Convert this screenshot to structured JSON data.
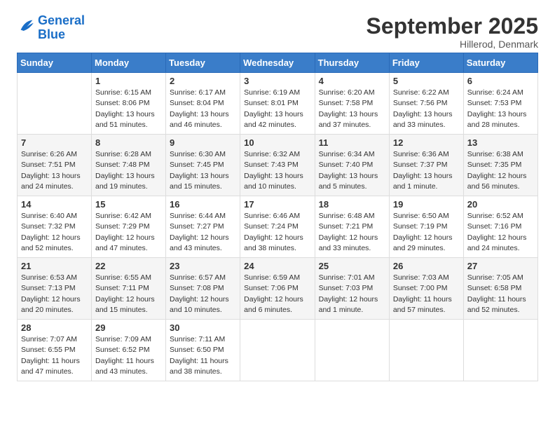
{
  "header": {
    "logo_general": "General",
    "logo_blue": "Blue",
    "month_title": "September 2025",
    "location": "Hillerod, Denmark"
  },
  "days_of_week": [
    "Sunday",
    "Monday",
    "Tuesday",
    "Wednesday",
    "Thursday",
    "Friday",
    "Saturday"
  ],
  "weeks": [
    [
      {
        "day": "",
        "sunrise": "",
        "sunset": "",
        "daylight": ""
      },
      {
        "day": "1",
        "sunrise": "Sunrise: 6:15 AM",
        "sunset": "Sunset: 8:06 PM",
        "daylight": "Daylight: 13 hours and 51 minutes."
      },
      {
        "day": "2",
        "sunrise": "Sunrise: 6:17 AM",
        "sunset": "Sunset: 8:04 PM",
        "daylight": "Daylight: 13 hours and 46 minutes."
      },
      {
        "day": "3",
        "sunrise": "Sunrise: 6:19 AM",
        "sunset": "Sunset: 8:01 PM",
        "daylight": "Daylight: 13 hours and 42 minutes."
      },
      {
        "day": "4",
        "sunrise": "Sunrise: 6:20 AM",
        "sunset": "Sunset: 7:58 PM",
        "daylight": "Daylight: 13 hours and 37 minutes."
      },
      {
        "day": "5",
        "sunrise": "Sunrise: 6:22 AM",
        "sunset": "Sunset: 7:56 PM",
        "daylight": "Daylight: 13 hours and 33 minutes."
      },
      {
        "day": "6",
        "sunrise": "Sunrise: 6:24 AM",
        "sunset": "Sunset: 7:53 PM",
        "daylight": "Daylight: 13 hours and 28 minutes."
      }
    ],
    [
      {
        "day": "7",
        "sunrise": "Sunrise: 6:26 AM",
        "sunset": "Sunset: 7:51 PM",
        "daylight": "Daylight: 13 hours and 24 minutes."
      },
      {
        "day": "8",
        "sunrise": "Sunrise: 6:28 AM",
        "sunset": "Sunset: 7:48 PM",
        "daylight": "Daylight: 13 hours and 19 minutes."
      },
      {
        "day": "9",
        "sunrise": "Sunrise: 6:30 AM",
        "sunset": "Sunset: 7:45 PM",
        "daylight": "Daylight: 13 hours and 15 minutes."
      },
      {
        "day": "10",
        "sunrise": "Sunrise: 6:32 AM",
        "sunset": "Sunset: 7:43 PM",
        "daylight": "Daylight: 13 hours and 10 minutes."
      },
      {
        "day": "11",
        "sunrise": "Sunrise: 6:34 AM",
        "sunset": "Sunset: 7:40 PM",
        "daylight": "Daylight: 13 hours and 5 minutes."
      },
      {
        "day": "12",
        "sunrise": "Sunrise: 6:36 AM",
        "sunset": "Sunset: 7:37 PM",
        "daylight": "Daylight: 13 hours and 1 minute."
      },
      {
        "day": "13",
        "sunrise": "Sunrise: 6:38 AM",
        "sunset": "Sunset: 7:35 PM",
        "daylight": "Daylight: 12 hours and 56 minutes."
      }
    ],
    [
      {
        "day": "14",
        "sunrise": "Sunrise: 6:40 AM",
        "sunset": "Sunset: 7:32 PM",
        "daylight": "Daylight: 12 hours and 52 minutes."
      },
      {
        "day": "15",
        "sunrise": "Sunrise: 6:42 AM",
        "sunset": "Sunset: 7:29 PM",
        "daylight": "Daylight: 12 hours and 47 minutes."
      },
      {
        "day": "16",
        "sunrise": "Sunrise: 6:44 AM",
        "sunset": "Sunset: 7:27 PM",
        "daylight": "Daylight: 12 hours and 43 minutes."
      },
      {
        "day": "17",
        "sunrise": "Sunrise: 6:46 AM",
        "sunset": "Sunset: 7:24 PM",
        "daylight": "Daylight: 12 hours and 38 minutes."
      },
      {
        "day": "18",
        "sunrise": "Sunrise: 6:48 AM",
        "sunset": "Sunset: 7:21 PM",
        "daylight": "Daylight: 12 hours and 33 minutes."
      },
      {
        "day": "19",
        "sunrise": "Sunrise: 6:50 AM",
        "sunset": "Sunset: 7:19 PM",
        "daylight": "Daylight: 12 hours and 29 minutes."
      },
      {
        "day": "20",
        "sunrise": "Sunrise: 6:52 AM",
        "sunset": "Sunset: 7:16 PM",
        "daylight": "Daylight: 12 hours and 24 minutes."
      }
    ],
    [
      {
        "day": "21",
        "sunrise": "Sunrise: 6:53 AM",
        "sunset": "Sunset: 7:13 PM",
        "daylight": "Daylight: 12 hours and 20 minutes."
      },
      {
        "day": "22",
        "sunrise": "Sunrise: 6:55 AM",
        "sunset": "Sunset: 7:11 PM",
        "daylight": "Daylight: 12 hours and 15 minutes."
      },
      {
        "day": "23",
        "sunrise": "Sunrise: 6:57 AM",
        "sunset": "Sunset: 7:08 PM",
        "daylight": "Daylight: 12 hours and 10 minutes."
      },
      {
        "day": "24",
        "sunrise": "Sunrise: 6:59 AM",
        "sunset": "Sunset: 7:06 PM",
        "daylight": "Daylight: 12 hours and 6 minutes."
      },
      {
        "day": "25",
        "sunrise": "Sunrise: 7:01 AM",
        "sunset": "Sunset: 7:03 PM",
        "daylight": "Daylight: 12 hours and 1 minute."
      },
      {
        "day": "26",
        "sunrise": "Sunrise: 7:03 AM",
        "sunset": "Sunset: 7:00 PM",
        "daylight": "Daylight: 11 hours and 57 minutes."
      },
      {
        "day": "27",
        "sunrise": "Sunrise: 7:05 AM",
        "sunset": "Sunset: 6:58 PM",
        "daylight": "Daylight: 11 hours and 52 minutes."
      }
    ],
    [
      {
        "day": "28",
        "sunrise": "Sunrise: 7:07 AM",
        "sunset": "Sunset: 6:55 PM",
        "daylight": "Daylight: 11 hours and 47 minutes."
      },
      {
        "day": "29",
        "sunrise": "Sunrise: 7:09 AM",
        "sunset": "Sunset: 6:52 PM",
        "daylight": "Daylight: 11 hours and 43 minutes."
      },
      {
        "day": "30",
        "sunrise": "Sunrise: 7:11 AM",
        "sunset": "Sunset: 6:50 PM",
        "daylight": "Daylight: 11 hours and 38 minutes."
      },
      {
        "day": "",
        "sunrise": "",
        "sunset": "",
        "daylight": ""
      },
      {
        "day": "",
        "sunrise": "",
        "sunset": "",
        "daylight": ""
      },
      {
        "day": "",
        "sunrise": "",
        "sunset": "",
        "daylight": ""
      },
      {
        "day": "",
        "sunrise": "",
        "sunset": "",
        "daylight": ""
      }
    ]
  ]
}
